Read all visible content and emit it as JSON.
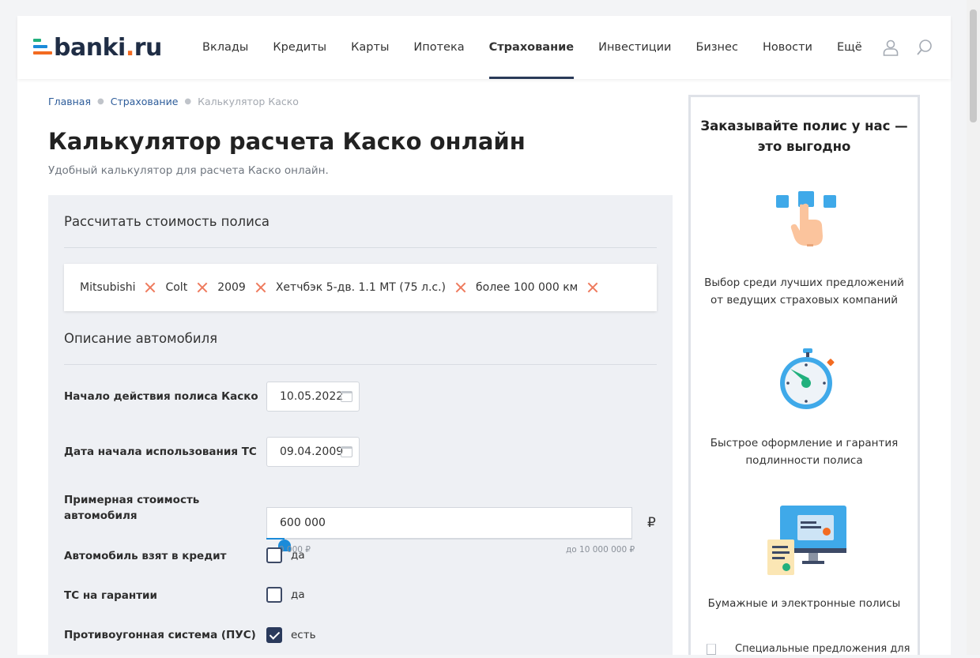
{
  "header": {
    "logo": "banki.ru",
    "logo_main": "banki",
    "logo_dot": ".",
    "logo_tld": "ru",
    "nav": [
      "Вклады",
      "Кредиты",
      "Карты",
      "Ипотека",
      "Страхование",
      "Инвестиции",
      "Бизнес",
      "Новости",
      "Ещё"
    ],
    "active_nav": "Страхование",
    "icons": [
      "user-icon",
      "search-icon"
    ]
  },
  "breadcrumb": [
    "Главная",
    "Страхование",
    "Калькулятор Каско"
  ],
  "page": {
    "title": "Калькулятор расчета Каско онлайн",
    "subtitle": "Удобный калькулятор для расчета Каско онлайн."
  },
  "calculator": {
    "heading": "Рассчитать стоимость полиса",
    "chips": [
      "Mitsubishi",
      "Colt",
      "2009",
      "Хетчбэк 5-дв. 1.1 MT (75 л.с.)",
      "более 100 000 км"
    ],
    "section": "Описание автомобиля",
    "policy_start": {
      "label": "Начало действия полиса Каско",
      "value": "10.05.2022"
    },
    "usage_start": {
      "label": "Дата начала использования ТС",
      "value": "09.04.2009"
    },
    "price": {
      "label_line1": "Примерная стоимость",
      "label_line2": "автомобиля",
      "value": "600 000",
      "currency": "₽",
      "min_label": "от 0 000 ₽",
      "max_label": "до 10 000 000 ₽",
      "slider_fraction": 0.05
    },
    "credit": {
      "label": "Автомобиль взят в кредит",
      "option": "да",
      "checked": false
    },
    "warranty": {
      "label": "ТС на гарантии",
      "option": "да",
      "checked": false
    },
    "antitheft": {
      "label": "Противоугонная система (ПУС)",
      "option": "есть",
      "checked": true
    }
  },
  "sidebar": {
    "title_line1": "Заказывайте полис у нас —",
    "title_line2": "это выгодно",
    "benefits": [
      {
        "icon": "hand-pointer-icon",
        "line1": "Выбор среди лучших предложений",
        "line2": "от ведущих страховых компаний"
      },
      {
        "icon": "stopwatch-icon",
        "line1": "Быстрое оформление и гарантия",
        "line2": "подлинности полиса"
      },
      {
        "icon": "monitor-document-icon",
        "line1": "Бумажные и электронные полисы",
        "line2": ""
      }
    ],
    "special_offer": "Специальные предложения для"
  },
  "colors": {
    "accent": "#2a3a5c",
    "link": "#2d5c9a",
    "remove": "#ee7a5d",
    "slider": "#1b8bd9",
    "orange": "#f36b21"
  }
}
